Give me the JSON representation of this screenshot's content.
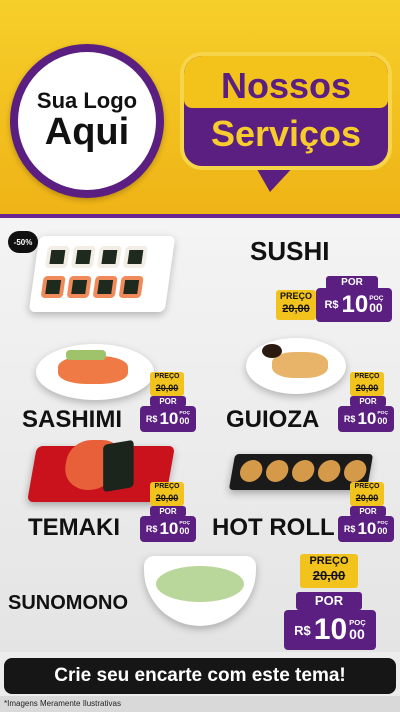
{
  "logo": {
    "line1": "Sua Logo",
    "line2": "Aqui"
  },
  "title": {
    "line1": "Nossos",
    "line2": "Serviços"
  },
  "discount_badge": "-50%",
  "currency": "R$",
  "labels": {
    "old": "PREÇO",
    "por": "POR",
    "poc": "POÇ"
  },
  "items": [
    {
      "name": "SUSHI",
      "old_price": "20,00",
      "new_int": "10",
      "new_dec": "00"
    },
    {
      "name": "SASHIMI",
      "old_price": "20,00",
      "new_int": "10",
      "new_dec": "00"
    },
    {
      "name": "GUIOZA",
      "old_price": "20,00",
      "new_int": "10",
      "new_dec": "00"
    },
    {
      "name": "TEMAKI",
      "old_price": "20,00",
      "new_int": "10",
      "new_dec": "00"
    },
    {
      "name": "HOT ROLL",
      "old_price": "20,00",
      "new_int": "10",
      "new_dec": "00"
    },
    {
      "name": "SUNOMONO",
      "old_price": "20,00",
      "new_int": "10",
      "new_dec": "00"
    }
  ],
  "cta": "Crie seu encarte com este tema!",
  "footer": "*Imagens Meramente Ilustrativas",
  "colors": {
    "purple": "#5a1f80",
    "yellow": "#f2c21d",
    "dark": "#161616"
  }
}
